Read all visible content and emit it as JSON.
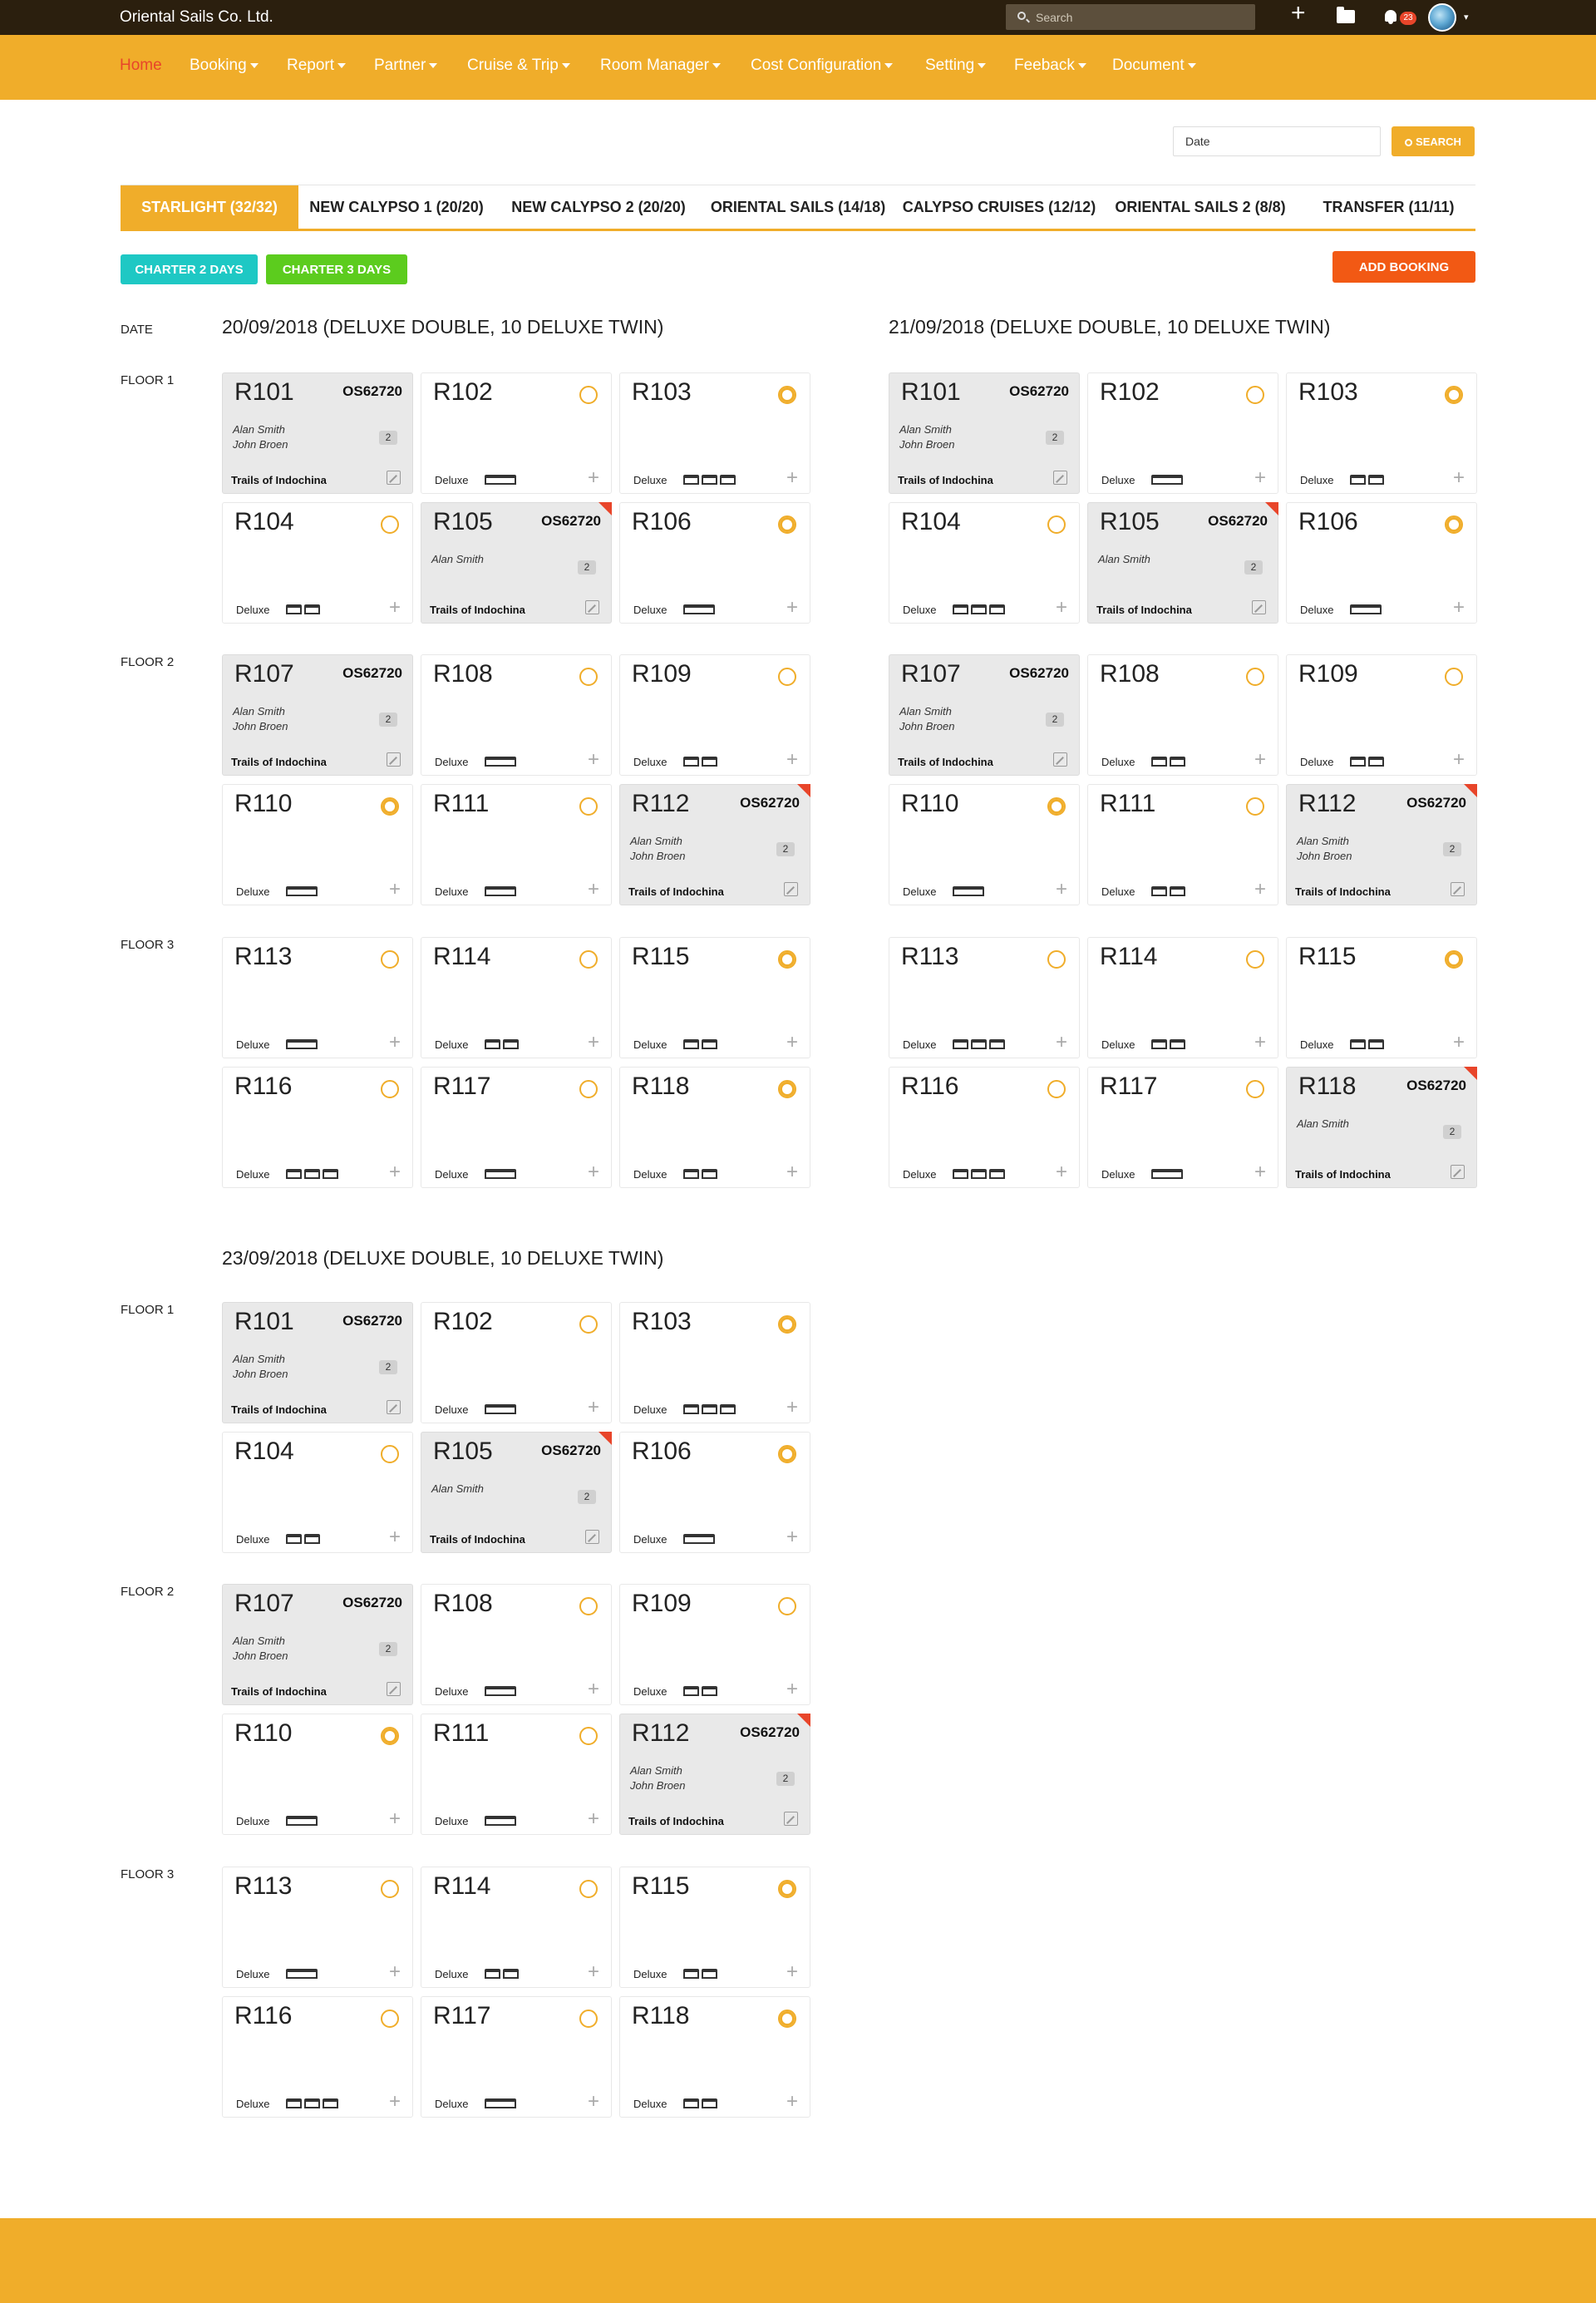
{
  "brand": "Oriental Sails Co. Ltd.",
  "topbar": {
    "search_placeholder": "Search",
    "notifications": "23"
  },
  "nav": [
    {
      "label": "Home",
      "active": true,
      "caret": false
    },
    {
      "label": "Booking",
      "caret": true
    },
    {
      "label": "Report",
      "caret": true
    },
    {
      "label": "Partner",
      "caret": true
    },
    {
      "label": "Cruise & Trip",
      "caret": true
    },
    {
      "label": "Room Manager",
      "caret": true
    },
    {
      "label": "Cost Configuration",
      "caret": true
    },
    {
      "label": "Setting",
      "caret": true
    },
    {
      "label": "Feeback",
      "caret": true
    },
    {
      "label": "Document",
      "caret": true
    }
  ],
  "filter": {
    "date_placeholder": "Date",
    "search_label": "SEARCH"
  },
  "tabs": [
    {
      "label": "STARLIGHT (32/32)",
      "active": true
    },
    {
      "label": "NEW CALYPSO 1 (20/20)"
    },
    {
      "label": "NEW CALYPSO 2 (20/20)"
    },
    {
      "label": "ORIENTAL SAILS (14/18)"
    },
    {
      "label": "CALYPSO CRUISES (12/12)"
    },
    {
      "label": "ORIENTAL SAILS 2 (8/8)"
    },
    {
      "label": "TRANSFER (11/11)"
    }
  ],
  "actions": {
    "charter2": "CHARTER 2 DAYS",
    "charter3": "CHARTER 3 DAYS",
    "add_booking": "ADD BOOKING"
  },
  "labels": {
    "date": "DATE",
    "floor1": "FLOOR 1",
    "floor2": "FLOOR 2",
    "floor3": "FLOOR 3"
  },
  "colors": {
    "accent": "#f0ad2a",
    "topbar": "#2b1f0e",
    "charter2": "#1ec8c4",
    "charter3": "#5ccc1e",
    "add_booking": "#f25914",
    "flag": "#e8452a"
  },
  "days": [
    {
      "title": "20/09/2018 (DELUXE DOUBLE, 10 DELUXE TWIN)",
      "floors": [
        [
          {
            "num": "R101",
            "booked": true,
            "code": "OS62720",
            "guests": [
              "Alan Smith",
              "John Broen"
            ],
            "pax": "2",
            "agency": "Trails of Indochina",
            "flag": false
          },
          {
            "num": "R102",
            "booked": false,
            "radio": "off",
            "type": "Deluxe",
            "beds": "double"
          },
          {
            "num": "R103",
            "booked": false,
            "radio": "on",
            "type": "Deluxe",
            "beds": "triple"
          },
          {
            "num": "R104",
            "booked": false,
            "radio": "off",
            "type": "Deluxe",
            "beds": "twin"
          },
          {
            "num": "R105",
            "booked": true,
            "code": "OS62720",
            "guests": [
              "Alan Smith"
            ],
            "pax": "2",
            "agency": "Trails of Indochina",
            "flag": true
          },
          {
            "num": "R106",
            "booked": false,
            "radio": "on",
            "type": "Deluxe",
            "beds": "double"
          }
        ],
        [
          {
            "num": "R107",
            "booked": true,
            "code": "OS62720",
            "guests": [
              "Alan Smith",
              "John Broen"
            ],
            "pax": "2",
            "agency": "Trails of Indochina",
            "flag": false
          },
          {
            "num": "R108",
            "booked": false,
            "radio": "off",
            "type": "Deluxe",
            "beds": "double"
          },
          {
            "num": "R109",
            "booked": false,
            "radio": "off",
            "type": "Deluxe",
            "beds": "twin"
          },
          {
            "num": "R110",
            "booked": false,
            "radio": "on",
            "type": "Deluxe",
            "beds": "double"
          },
          {
            "num": "R111",
            "booked": false,
            "radio": "off",
            "type": "Deluxe",
            "beds": "double"
          },
          {
            "num": "R112",
            "booked": true,
            "code": "OS62720",
            "guests": [
              "Alan Smith",
              "John Broen"
            ],
            "pax": "2",
            "agency": "Trails of Indochina",
            "flag": true
          }
        ],
        [
          {
            "num": "R113",
            "booked": false,
            "radio": "off",
            "type": "Deluxe",
            "beds": "double"
          },
          {
            "num": "R114",
            "booked": false,
            "radio": "off",
            "type": "Deluxe",
            "beds": "twin"
          },
          {
            "num": "R115",
            "booked": false,
            "radio": "on",
            "type": "Deluxe",
            "beds": "twin"
          },
          {
            "num": "R116",
            "booked": false,
            "radio": "off",
            "type": "Deluxe",
            "beds": "triple"
          },
          {
            "num": "R117",
            "booked": false,
            "radio": "off",
            "type": "Deluxe",
            "beds": "double"
          },
          {
            "num": "R118",
            "booked": false,
            "radio": "on",
            "type": "Deluxe",
            "beds": "twin"
          }
        ]
      ]
    },
    {
      "title": "21/09/2018 (DELUXE DOUBLE, 10 DELUXE TWIN)",
      "floors": [
        [
          {
            "num": "R101",
            "booked": true,
            "code": "OS62720",
            "guests": [
              "Alan Smith",
              "John Broen"
            ],
            "pax": "2",
            "agency": "Trails of Indochina",
            "flag": false
          },
          {
            "num": "R102",
            "booked": false,
            "radio": "off",
            "type": "Deluxe",
            "beds": "double"
          },
          {
            "num": "R103",
            "booked": false,
            "radio": "on",
            "type": "Deluxe",
            "beds": "twin"
          },
          {
            "num": "R104",
            "booked": false,
            "radio": "off",
            "type": "Deluxe",
            "beds": "triple"
          },
          {
            "num": "R105",
            "booked": true,
            "code": "OS62720",
            "guests": [
              "Alan Smith"
            ],
            "pax": "2",
            "agency": "Trails of Indochina",
            "flag": true
          },
          {
            "num": "R106",
            "booked": false,
            "radio": "on",
            "type": "Deluxe",
            "beds": "double"
          }
        ],
        [
          {
            "num": "R107",
            "booked": true,
            "code": "OS62720",
            "guests": [
              "Alan Smith",
              "John Broen"
            ],
            "pax": "2",
            "agency": "Trails of Indochina",
            "flag": false
          },
          {
            "num": "R108",
            "booked": false,
            "radio": "off",
            "type": "Deluxe",
            "beds": "twin"
          },
          {
            "num": "R109",
            "booked": false,
            "radio": "off",
            "type": "Deluxe",
            "beds": "twin"
          },
          {
            "num": "R110",
            "booked": false,
            "radio": "on",
            "type": "Deluxe",
            "beds": "double"
          },
          {
            "num": "R111",
            "booked": false,
            "radio": "off",
            "type": "Deluxe",
            "beds": "twin"
          },
          {
            "num": "R112",
            "booked": true,
            "code": "OS62720",
            "guests": [
              "Alan Smith",
              "John Broen"
            ],
            "pax": "2",
            "agency": "Trails of Indochina",
            "flag": true
          }
        ],
        [
          {
            "num": "R113",
            "booked": false,
            "radio": "off",
            "type": "Deluxe",
            "beds": "triple"
          },
          {
            "num": "R114",
            "booked": false,
            "radio": "off",
            "type": "Deluxe",
            "beds": "twin"
          },
          {
            "num": "R115",
            "booked": false,
            "radio": "on",
            "type": "Deluxe",
            "beds": "twin"
          },
          {
            "num": "R116",
            "booked": false,
            "radio": "off",
            "type": "Deluxe",
            "beds": "triple"
          },
          {
            "num": "R117",
            "booked": false,
            "radio": "off",
            "type": "Deluxe",
            "beds": "double"
          },
          {
            "num": "R118",
            "booked": true,
            "code": "OS62720",
            "guests": [
              "Alan Smith"
            ],
            "pax": "2",
            "agency": "Trails of Indochina",
            "flag": true
          }
        ]
      ]
    },
    {
      "title": "23/09/2018 (DELUXE DOUBLE, 10 DELUXE TWIN)",
      "floors": [
        [
          {
            "num": "R101",
            "booked": true,
            "code": "OS62720",
            "guests": [
              "Alan Smith",
              "John Broen"
            ],
            "pax": "2",
            "agency": "Trails of Indochina",
            "flag": false
          },
          {
            "num": "R102",
            "booked": false,
            "radio": "off",
            "type": "Deluxe",
            "beds": "double"
          },
          {
            "num": "R103",
            "booked": false,
            "radio": "on",
            "type": "Deluxe",
            "beds": "triple"
          },
          {
            "num": "R104",
            "booked": false,
            "radio": "off",
            "type": "Deluxe",
            "beds": "twin"
          },
          {
            "num": "R105",
            "booked": true,
            "code": "OS62720",
            "guests": [
              "Alan Smith"
            ],
            "pax": "2",
            "agency": "Trails of Indochina",
            "flag": true
          },
          {
            "num": "R106",
            "booked": false,
            "radio": "on",
            "type": "Deluxe",
            "beds": "double"
          }
        ],
        [
          {
            "num": "R107",
            "booked": true,
            "code": "OS62720",
            "guests": [
              "Alan Smith",
              "John Broen"
            ],
            "pax": "2",
            "agency": "Trails of Indochina",
            "flag": false
          },
          {
            "num": "R108",
            "booked": false,
            "radio": "off",
            "type": "Deluxe",
            "beds": "double"
          },
          {
            "num": "R109",
            "booked": false,
            "radio": "off",
            "type": "Deluxe",
            "beds": "twin"
          },
          {
            "num": "R110",
            "booked": false,
            "radio": "on",
            "type": "Deluxe",
            "beds": "double"
          },
          {
            "num": "R111",
            "booked": false,
            "radio": "off",
            "type": "Deluxe",
            "beds": "double"
          },
          {
            "num": "R112",
            "booked": true,
            "code": "OS62720",
            "guests": [
              "Alan Smith",
              "John Broen"
            ],
            "pax": "2",
            "agency": "Trails of Indochina",
            "flag": true
          }
        ],
        [
          {
            "num": "R113",
            "booked": false,
            "radio": "off",
            "type": "Deluxe",
            "beds": "double"
          },
          {
            "num": "R114",
            "booked": false,
            "radio": "off",
            "type": "Deluxe",
            "beds": "twin"
          },
          {
            "num": "R115",
            "booked": false,
            "radio": "on",
            "type": "Deluxe",
            "beds": "twin"
          },
          {
            "num": "R116",
            "booked": false,
            "radio": "off",
            "type": "Deluxe",
            "beds": "triple"
          },
          {
            "num": "R117",
            "booked": false,
            "radio": "off",
            "type": "Deluxe",
            "beds": "double"
          },
          {
            "num": "R118",
            "booked": false,
            "radio": "on",
            "type": "Deluxe",
            "beds": "twin"
          }
        ]
      ]
    }
  ]
}
